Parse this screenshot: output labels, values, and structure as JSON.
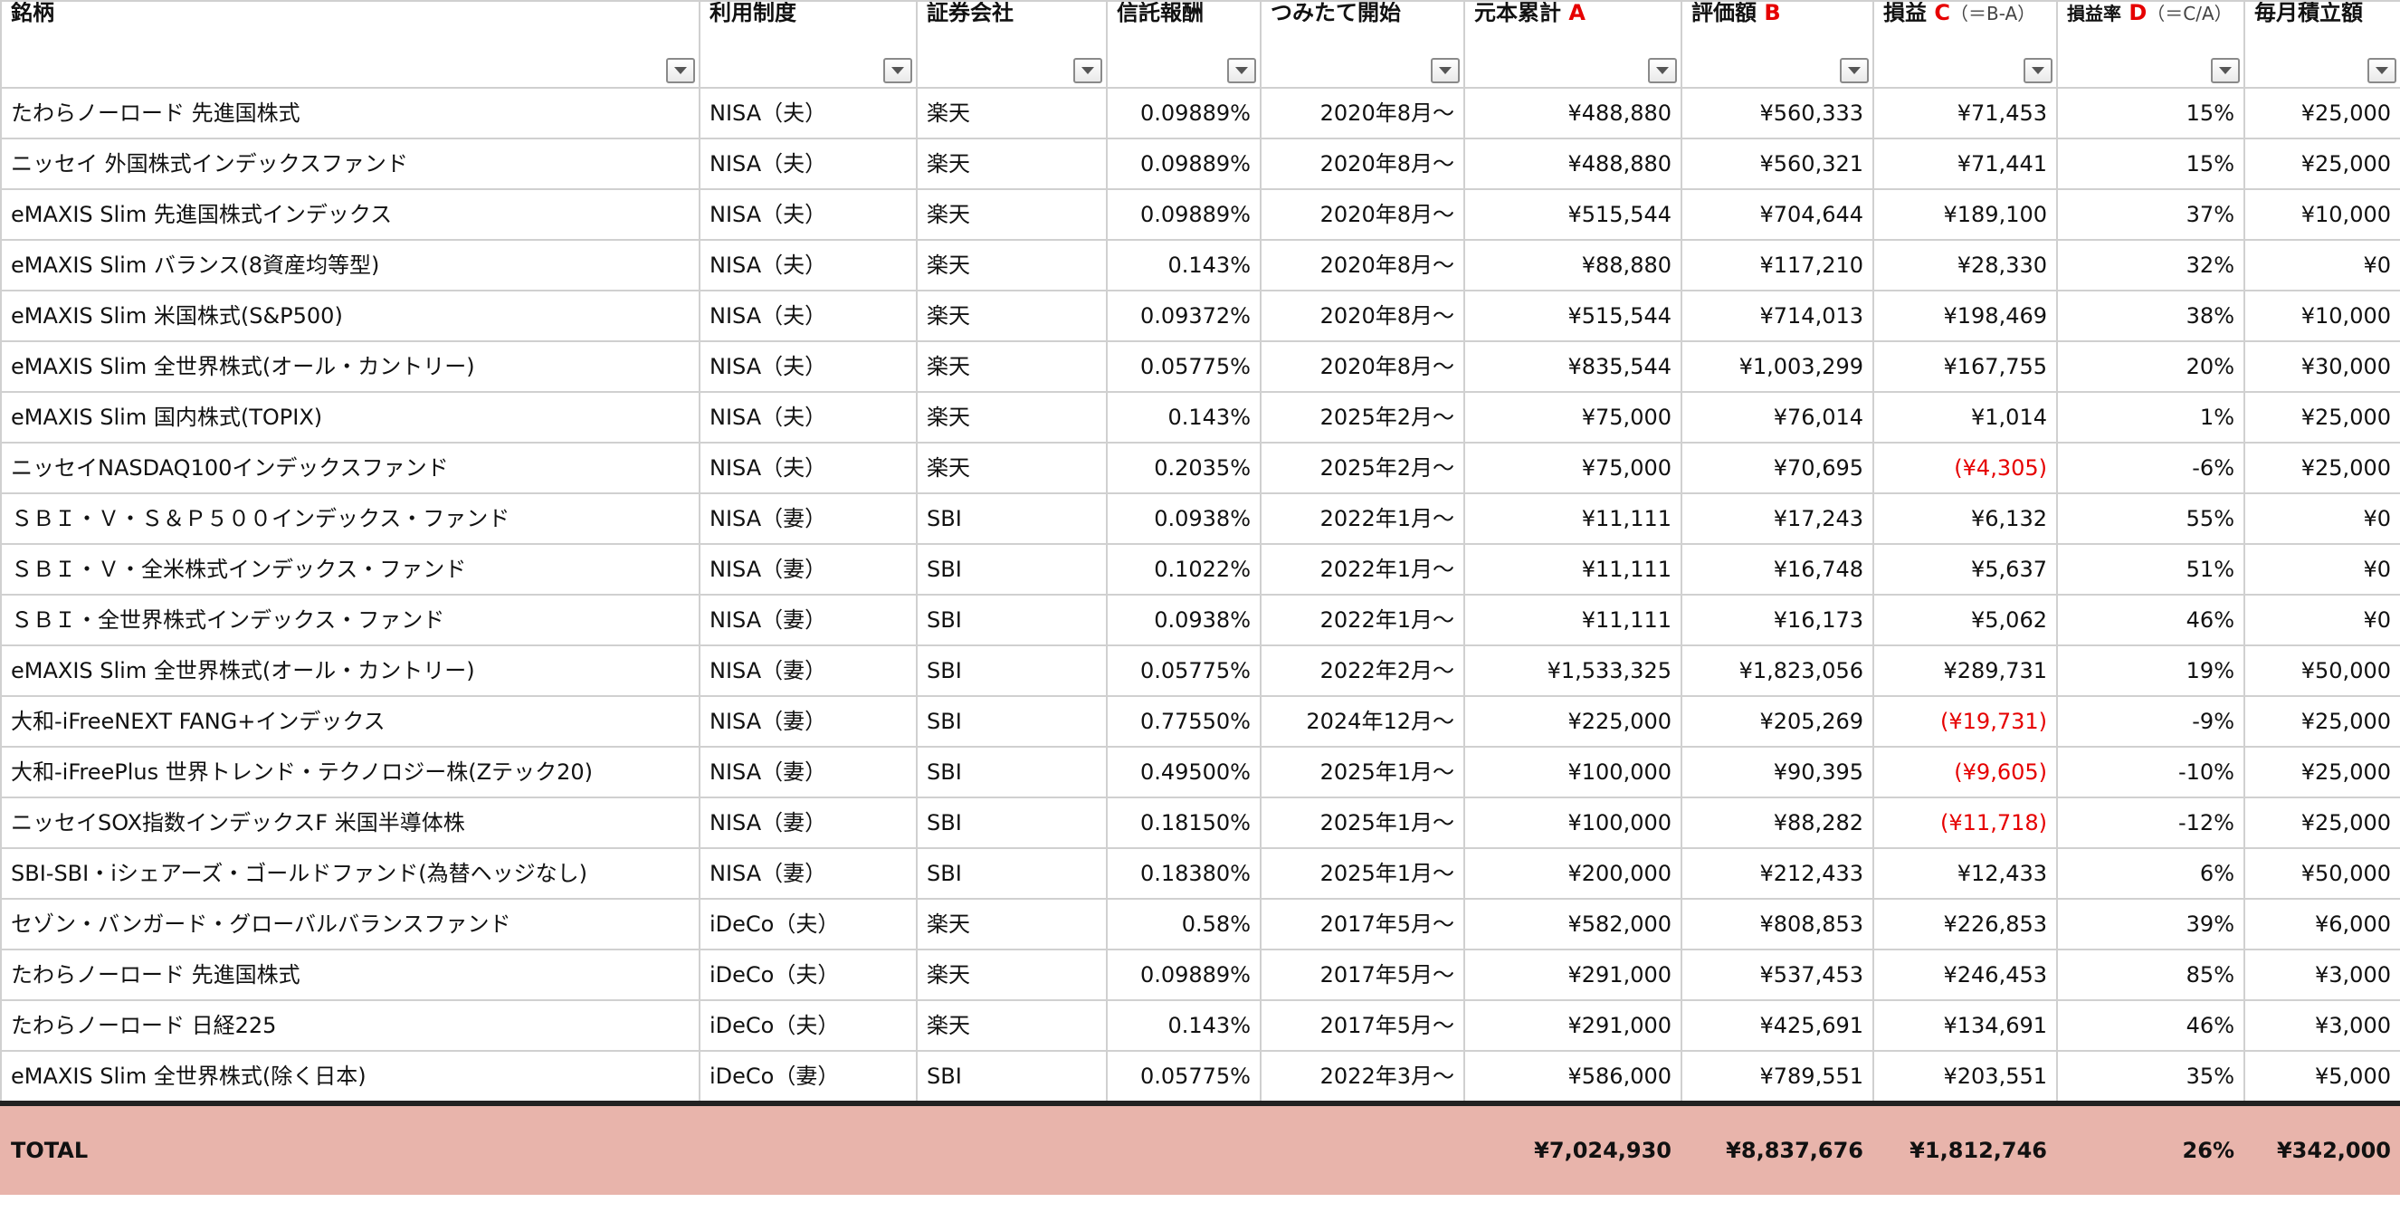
{
  "headers": [
    {
      "text": "銘柄"
    },
    {
      "text": "利用制度"
    },
    {
      "text": "証券会社"
    },
    {
      "text": "信託報酬"
    },
    {
      "text": "つみたて開始"
    },
    {
      "text": "元本累計",
      "mark": "A"
    },
    {
      "text": "評価額",
      "mark": "B"
    },
    {
      "text": "損益",
      "mark": "C",
      "note": "（＝B-A）"
    },
    {
      "text": "損益率",
      "mark": "D",
      "note": "（＝C/A）"
    },
    {
      "text": "毎月積立額"
    }
  ],
  "rows": [
    {
      "name": "たわらノーロード 先進国株式",
      "system": "NISA（夫）",
      "broker": "楽天",
      "fee": "0.09889%",
      "start": "2020年8月〜",
      "principal": "¥488,880",
      "value": "¥560,333",
      "pl": "¥71,453",
      "rate": "15%",
      "monthly": "¥25,000",
      "neg": false
    },
    {
      "name": "ニッセイ 外国株式インデックスファンド",
      "system": "NISA（夫）",
      "broker": "楽天",
      "fee": "0.09889%",
      "start": "2020年8月〜",
      "principal": "¥488,880",
      "value": "¥560,321",
      "pl": "¥71,441",
      "rate": "15%",
      "monthly": "¥25,000",
      "neg": false
    },
    {
      "name": "eMAXIS Slim 先進国株式インデックス",
      "system": "NISA（夫）",
      "broker": "楽天",
      "fee": "0.09889%",
      "start": "2020年8月〜",
      "principal": "¥515,544",
      "value": "¥704,644",
      "pl": "¥189,100",
      "rate": "37%",
      "monthly": "¥10,000",
      "neg": false
    },
    {
      "name": "eMAXIS Slim バランス(8資産均等型)",
      "system": "NISA（夫）",
      "broker": "楽天",
      "fee": "0.143%",
      "start": "2020年8月〜",
      "principal": "¥88,880",
      "value": "¥117,210",
      "pl": "¥28,330",
      "rate": "32%",
      "monthly": "¥0",
      "neg": false
    },
    {
      "name": "eMAXIS Slim 米国株式(S&P500)",
      "system": "NISA（夫）",
      "broker": "楽天",
      "fee": "0.09372%",
      "start": "2020年8月〜",
      "principal": "¥515,544",
      "value": "¥714,013",
      "pl": "¥198,469",
      "rate": "38%",
      "monthly": "¥10,000",
      "neg": false
    },
    {
      "name": "eMAXIS Slim 全世界株式(オール・カントリー)",
      "system": "NISA（夫）",
      "broker": "楽天",
      "fee": "0.05775%",
      "start": "2020年8月〜",
      "principal": "¥835,544",
      "value": "¥1,003,299",
      "pl": "¥167,755",
      "rate": "20%",
      "monthly": "¥30,000",
      "neg": false
    },
    {
      "name": "eMAXIS Slim 国内株式(TOPIX)",
      "system": "NISA（夫）",
      "broker": "楽天",
      "fee": "0.143%",
      "start": "2025年2月〜",
      "principal": "¥75,000",
      "value": "¥76,014",
      "pl": "¥1,014",
      "rate": "1%",
      "monthly": "¥25,000",
      "neg": false
    },
    {
      "name": "ニッセイNASDAQ100インデックスファンド",
      "system": "NISA（夫）",
      "broker": "楽天",
      "fee": "0.2035%",
      "start": "2025年2月〜",
      "principal": "¥75,000",
      "value": "¥70,695",
      "pl": "(¥4,305)",
      "rate": "-6%",
      "monthly": "¥25,000",
      "neg": true
    },
    {
      "name": "ＳＢＩ・Ｖ・Ｓ＆Ｐ５００インデックス・ファンド",
      "system": "NISA（妻）",
      "broker": "SBI",
      "fee": "0.0938%",
      "start": "2022年1月〜",
      "principal": "¥11,111",
      "value": "¥17,243",
      "pl": "¥6,132",
      "rate": "55%",
      "monthly": "¥0",
      "neg": false
    },
    {
      "name": "ＳＢＩ・Ｖ・全米株式インデックス・ファンド",
      "system": "NISA（妻）",
      "broker": "SBI",
      "fee": "0.1022%",
      "start": "2022年1月〜",
      "principal": "¥11,111",
      "value": "¥16,748",
      "pl": "¥5,637",
      "rate": "51%",
      "monthly": "¥0",
      "neg": false
    },
    {
      "name": "ＳＢＩ・全世界株式インデックス・ファンド",
      "system": "NISA（妻）",
      "broker": "SBI",
      "fee": "0.0938%",
      "start": "2022年1月〜",
      "principal": "¥11,111",
      "value": "¥16,173",
      "pl": "¥5,062",
      "rate": "46%",
      "monthly": "¥0",
      "neg": false
    },
    {
      "name": "eMAXIS Slim 全世界株式(オール・カントリー)",
      "system": "NISA（妻）",
      "broker": "SBI",
      "fee": "0.05775%",
      "start": "2022年2月〜",
      "principal": "¥1,533,325",
      "value": "¥1,823,056",
      "pl": "¥289,731",
      "rate": "19%",
      "monthly": "¥50,000",
      "neg": false
    },
    {
      "name": "大和-iFreeNEXT FANG+インデックス",
      "system": "NISA（妻）",
      "broker": "SBI",
      "fee": "0.77550%",
      "start": "2024年12月〜",
      "principal": "¥225,000",
      "value": "¥205,269",
      "pl": "(¥19,731)",
      "rate": "-9%",
      "monthly": "¥25,000",
      "neg": true
    },
    {
      "name": "大和-iFreePlus 世界トレンド・テクノロジー株(Zテック20)",
      "system": "NISA（妻）",
      "broker": "SBI",
      "fee": "0.49500%",
      "start": "2025年1月〜",
      "principal": "¥100,000",
      "value": "¥90,395",
      "pl": "(¥9,605)",
      "rate": "-10%",
      "monthly": "¥25,000",
      "neg": true
    },
    {
      "name": "ニッセイSOX指数インデックスF 米国半導体株",
      "system": "NISA（妻）",
      "broker": "SBI",
      "fee": "0.18150%",
      "start": "2025年1月〜",
      "principal": "¥100,000",
      "value": "¥88,282",
      "pl": "(¥11,718)",
      "rate": "-12%",
      "monthly": "¥25,000",
      "neg": true
    },
    {
      "name": "SBI-SBI・iシェアーズ・ゴールドファンド(為替ヘッジなし)",
      "system": "NISA（妻）",
      "broker": "SBI",
      "fee": "0.18380%",
      "start": "2025年1月〜",
      "principal": "¥200,000",
      "value": "¥212,433",
      "pl": "¥12,433",
      "rate": "6%",
      "monthly": "¥50,000",
      "neg": false
    },
    {
      "name": "セゾン・バンガード・グローバルバランスファンド",
      "system": "iDeCo（夫）",
      "broker": "楽天",
      "fee": "0.58%",
      "start": "2017年5月〜",
      "principal": "¥582,000",
      "value": "¥808,853",
      "pl": "¥226,853",
      "rate": "39%",
      "monthly": "¥6,000",
      "neg": false
    },
    {
      "name": "たわらノーロード 先進国株式",
      "system": "iDeCo（夫）",
      "broker": "楽天",
      "fee": "0.09889%",
      "start": "2017年5月〜",
      "principal": "¥291,000",
      "value": "¥537,453",
      "pl": "¥246,453",
      "rate": "85%",
      "monthly": "¥3,000",
      "neg": false
    },
    {
      "name": "たわらノーロード 日経225",
      "system": "iDeCo（夫）",
      "broker": "楽天",
      "fee": "0.143%",
      "start": "2017年5月〜",
      "principal": "¥291,000",
      "value": "¥425,691",
      "pl": "¥134,691",
      "rate": "46%",
      "monthly": "¥3,000",
      "neg": false
    },
    {
      "name": "eMAXIS Slim 全世界株式(除く日本)",
      "system": "iDeCo（妻）",
      "broker": "SBI",
      "fee": "0.05775%",
      "start": "2022年3月〜",
      "principal": "¥586,000",
      "value": "¥789,551",
      "pl": "¥203,551",
      "rate": "35%",
      "monthly": "¥5,000",
      "neg": false
    }
  ],
  "total": {
    "label": "TOTAL",
    "principal": "¥7,024,930",
    "value": "¥8,837,676",
    "pl": "¥1,812,746",
    "rate": "26%",
    "monthly": "¥342,000"
  },
  "colors": {
    "negative": "#e60000",
    "total_bg": "#e8b4ab",
    "mark": "#e60000"
  },
  "icons": {
    "filter": "filter-dropdown-icon"
  }
}
